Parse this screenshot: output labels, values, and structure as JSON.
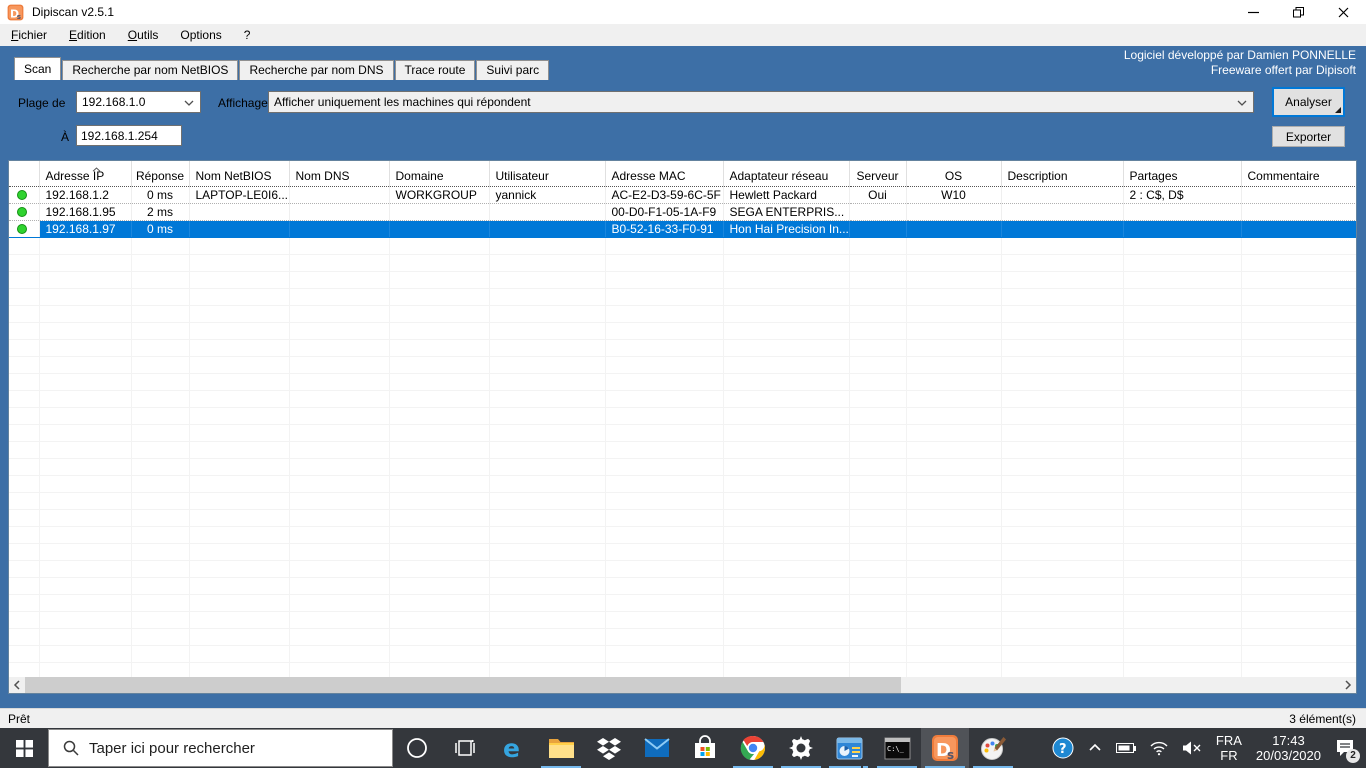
{
  "window": {
    "title": "Dipiscan v2.5.1",
    "controls": {
      "minimize": "minimize",
      "restore": "restore",
      "close": "close"
    }
  },
  "menu": {
    "items": [
      {
        "key": "F",
        "rest": "ichier"
      },
      {
        "key": "E",
        "rest": "dition"
      },
      {
        "key": "O",
        "rest": "utils"
      },
      {
        "key": "",
        "rest": "Options"
      },
      {
        "key": "",
        "rest": "?"
      }
    ]
  },
  "credit": {
    "line1": "Logiciel développé par Damien PONNELLE",
    "line2": "Freeware offert par Dipisoft"
  },
  "tabs": {
    "active_index": 0,
    "items": [
      "Scan",
      "Recherche par nom NetBIOS",
      "Recherche par nom DNS",
      "Trace route",
      "Suivi parc"
    ]
  },
  "controls": {
    "plage_label": "Plage de",
    "plage_value": "192.168.1.0",
    "a_label": "À",
    "a_value": "192.168.1.254",
    "affichage_label": "Affichage",
    "affichage_value": "Afficher uniquement les machines qui répondent",
    "analyser_label": "Analyser",
    "exporter_label": "Exporter"
  },
  "table": {
    "columns": [
      "",
      "Adresse IP",
      "Réponse",
      "Nom NetBIOS",
      "Nom DNS",
      "Domaine",
      "Utilisateur",
      "Adresse MAC",
      "Adaptateur réseau",
      "Serveur",
      "OS",
      "Description",
      "Partages",
      "Commentaire"
    ],
    "sorted_column": "Adresse IP",
    "selected_row_index": 2,
    "rows": [
      {
        "status": "up",
        "cells": [
          "192.168.1.2",
          "0 ms",
          "LAPTOP-LE0I6...",
          "",
          "WORKGROUP",
          "yannick",
          "AC-E2-D3-59-6C-5F",
          "Hewlett Packard",
          "Oui",
          "W10",
          "",
          "2 : C$, D$",
          ""
        ]
      },
      {
        "status": "up",
        "cells": [
          "192.168.1.95",
          "2 ms",
          "",
          "",
          "",
          "",
          "00-D0-F1-05-1A-F9",
          "SEGA ENTERPRIS...",
          "",
          "",
          "",
          "",
          ""
        ]
      },
      {
        "status": "up",
        "cells": [
          "192.168.1.97",
          "0 ms",
          "",
          "",
          "",
          "",
          "B0-52-16-33-F0-91",
          "Hon Hai Precision In...",
          "",
          "",
          "",
          "",
          ""
        ]
      }
    ]
  },
  "statusbar": {
    "left": "Prêt",
    "right": "3 élément(s)"
  },
  "taskbar": {
    "search_placeholder": "Taper ici pour rechercher",
    "apps": [
      {
        "icon": "edge",
        "open": false,
        "active": false,
        "windows": 1
      },
      {
        "icon": "file-explorer",
        "open": true,
        "active": false,
        "windows": 1
      },
      {
        "icon": "dropbox",
        "open": false,
        "active": false,
        "windows": 1
      },
      {
        "icon": "mail",
        "open": false,
        "active": false,
        "windows": 1
      },
      {
        "icon": "store",
        "open": false,
        "active": false,
        "windows": 1
      },
      {
        "icon": "chrome",
        "open": true,
        "active": false,
        "windows": 1
      },
      {
        "icon": "settings",
        "open": true,
        "active": false,
        "windows": 1
      },
      {
        "icon": "report-app",
        "open": true,
        "active": false,
        "windows": 2
      },
      {
        "icon": "command-prompt",
        "open": true,
        "active": false,
        "windows": 1
      },
      {
        "icon": "dipiscan",
        "open": true,
        "active": true,
        "windows": 1
      },
      {
        "icon": "paint",
        "open": true,
        "active": false,
        "windows": 1
      }
    ],
    "tray": {
      "language_line1": "FRA",
      "language_line2": "FR",
      "time": "17:43",
      "date": "20/03/2020",
      "notification_badge": "2"
    }
  },
  "colors": {
    "form_background": "#3d6fa6",
    "selection_blue": "#0078d7",
    "status_green": "#2fd32f",
    "taskbar_background": "#34373c",
    "open_app_underline": "#76b9ed",
    "dipiscan_orange": "#ee7c3c"
  }
}
